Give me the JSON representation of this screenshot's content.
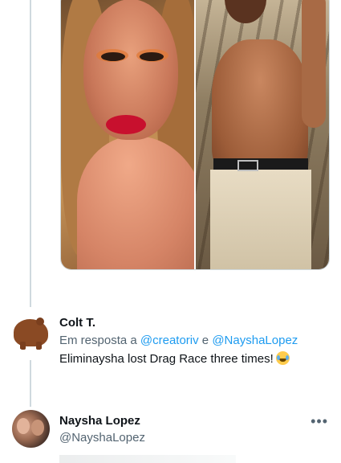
{
  "reply": {
    "author_name": "Colt T.",
    "replying_prefix": "Em resposta a ",
    "mention1": "@creatoriv",
    "conjunction": " e ",
    "mention2": "@NayshaLopez",
    "text": "Eliminaysha lost Drag Race three times!",
    "emoji": "face-with-tears-of-joy",
    "avatar": "wombat-avatar"
  },
  "next_tweet": {
    "author_name": "Naysha Lopez",
    "handle": "@NayshaLopez",
    "more_label": "•••"
  },
  "media": {
    "left": "drag-queen-portrait",
    "right": "shirtless-man-on-railroad-tracks"
  }
}
